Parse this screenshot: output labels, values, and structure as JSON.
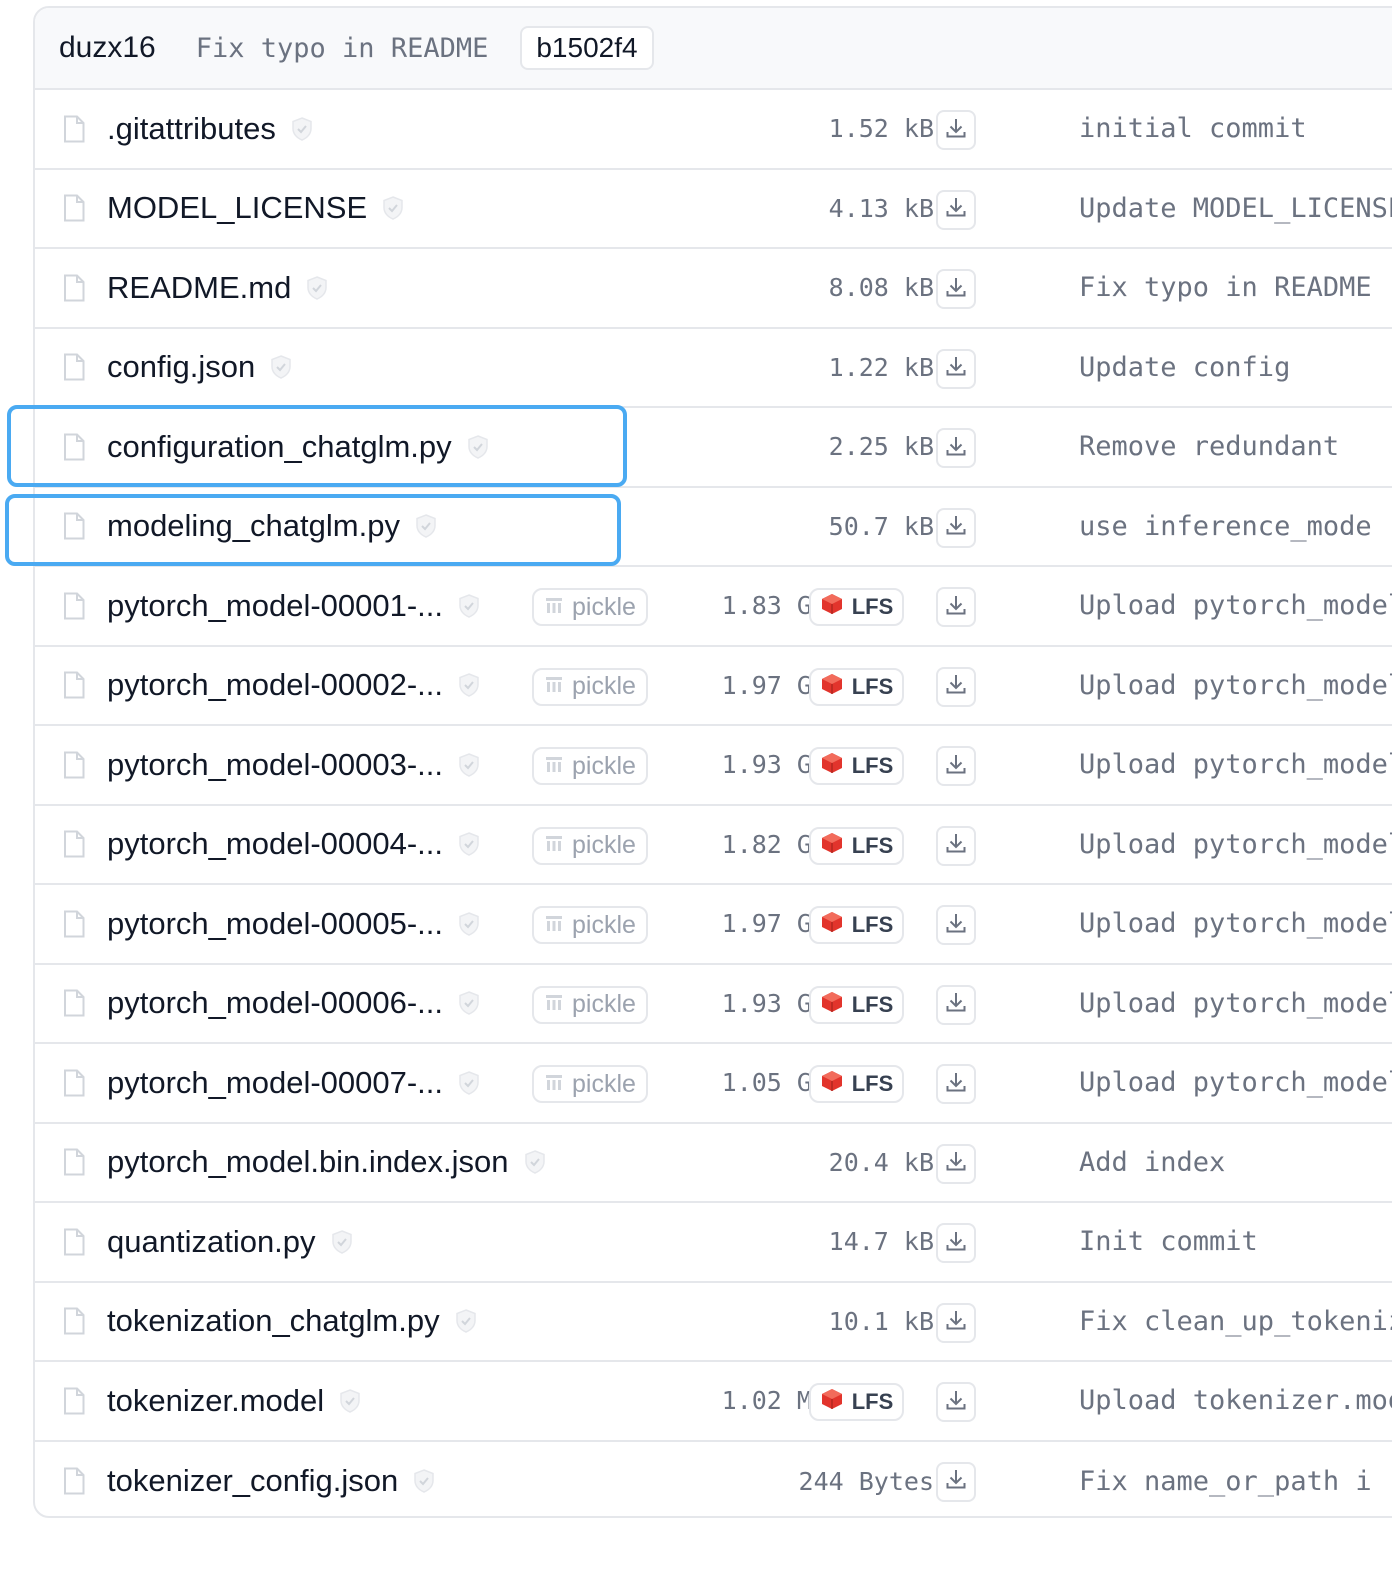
{
  "header": {
    "author": "duzx16",
    "commit_message": "Fix typo in README",
    "commit_sha": "b1502f4"
  },
  "icons": {
    "file": "file-icon",
    "safe": "shield-check-icon",
    "pickle": "pickle-icon",
    "lfs": "lfs-icon",
    "download": "download-icon"
  },
  "colors": {
    "highlight": "#4aaaf2",
    "lfs_red": "#e2342c"
  },
  "badges": {
    "pickle_label": "pickle",
    "lfs_label": "LFS"
  },
  "files": [
    {
      "name": ".gitattributes",
      "size": "1.52 kB",
      "commit": "initial commit",
      "pickle": false,
      "lfs": false
    },
    {
      "name": "MODEL_LICENSE",
      "size": "4.13 kB",
      "commit": "Update MODEL_LICENSE",
      "pickle": false,
      "lfs": false
    },
    {
      "name": "README.md",
      "size": "8.08 kB",
      "commit": "Fix typo in README",
      "pickle": false,
      "lfs": false
    },
    {
      "name": "config.json",
      "size": "1.22 kB",
      "commit": "Update config",
      "pickle": false,
      "lfs": false
    },
    {
      "name": "configuration_chatglm.py",
      "size": "2.25 kB",
      "commit": "Remove redundant",
      "pickle": false,
      "lfs": false,
      "highlighted": true
    },
    {
      "name": "modeling_chatglm.py",
      "size": "50.7 kB",
      "commit": "use inference_mode",
      "pickle": false,
      "lfs": false,
      "highlighted": true
    },
    {
      "name": "pytorch_model-00001-...",
      "size": "1.83 GB",
      "commit": "Upload pytorch_model",
      "pickle": true,
      "lfs": true
    },
    {
      "name": "pytorch_model-00002-...",
      "size": "1.97 GB",
      "commit": "Upload pytorch_model",
      "pickle": true,
      "lfs": true
    },
    {
      "name": "pytorch_model-00003-...",
      "size": "1.93 GB",
      "commit": "Upload pytorch_model",
      "pickle": true,
      "lfs": true
    },
    {
      "name": "pytorch_model-00004-...",
      "size": "1.82 GB",
      "commit": "Upload pytorch_model",
      "pickle": true,
      "lfs": true
    },
    {
      "name": "pytorch_model-00005-...",
      "size": "1.97 GB",
      "commit": "Upload pytorch_model",
      "pickle": true,
      "lfs": true
    },
    {
      "name": "pytorch_model-00006-...",
      "size": "1.93 GB",
      "commit": "Upload pytorch_model",
      "pickle": true,
      "lfs": true
    },
    {
      "name": "pytorch_model-00007-...",
      "size": "1.05 GB",
      "commit": "Upload pytorch_model",
      "pickle": true,
      "lfs": true
    },
    {
      "name": "pytorch_model.bin.index.json",
      "size": "20.4 kB",
      "commit": "Add index",
      "pickle": false,
      "lfs": false
    },
    {
      "name": "quantization.py",
      "size": "14.7 kB",
      "commit": "Init commit",
      "pickle": false,
      "lfs": false
    },
    {
      "name": "tokenization_chatglm.py",
      "size": "10.1 kB",
      "commit": "Fix clean_up_tokenization",
      "pickle": false,
      "lfs": false
    },
    {
      "name": "tokenizer.model",
      "size": "1.02 MB",
      "commit": "Upload tokenizer.model",
      "pickle": false,
      "lfs": true
    },
    {
      "name": "tokenizer_config.json",
      "size": "244 Bytes",
      "commit": "Fix name_or_path i",
      "pickle": false,
      "lfs": false
    }
  ]
}
